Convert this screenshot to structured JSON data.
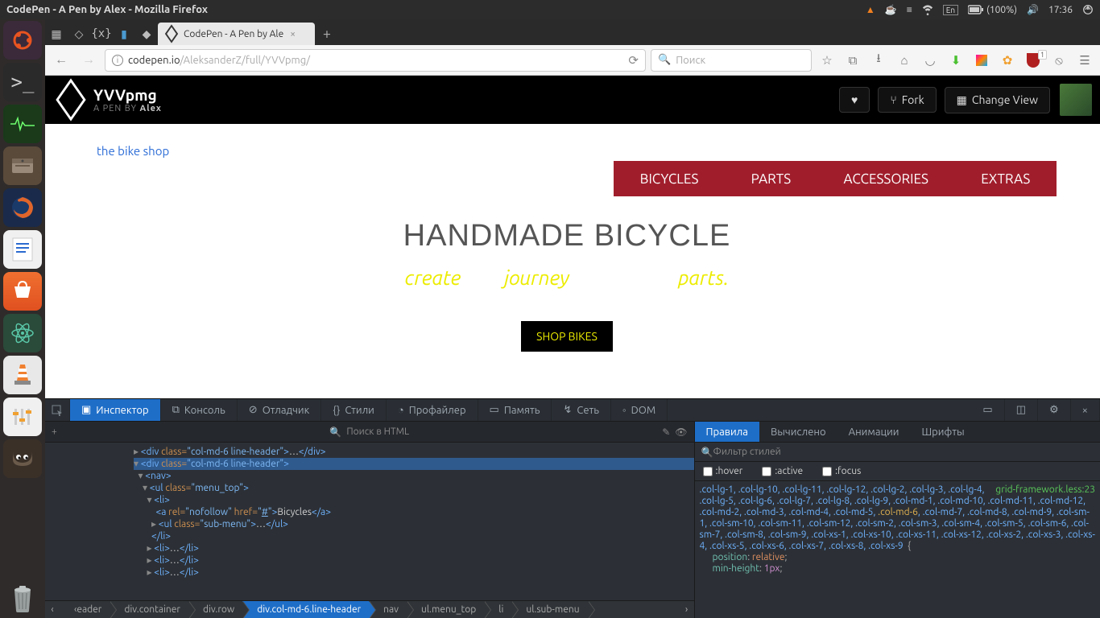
{
  "sysbar": {
    "title": "CodePen - A Pen by Alex - Mozilla Firefox",
    "battery": "(100%)",
    "lang": "En",
    "time": "17:36"
  },
  "tabs": {
    "active": "CodePen - A Pen by Ale"
  },
  "url": {
    "prefix": "codepen.io",
    "path": "/AleksanderZ/full/YVVpmg/",
    "search_placeholder": "Поиск"
  },
  "codepen": {
    "name": "YVVpmg",
    "by_prefix": "A PEN BY ",
    "author": "Alex",
    "fork": "Fork",
    "change_view": "Change View"
  },
  "page": {
    "shoplink": "the bike shop",
    "nav": [
      "BICYCLES",
      "PARTS",
      "ACCESSORIES",
      "EXTRAS"
    ],
    "h1": "HANDMADE BICYCLE",
    "subwords": [
      "create",
      "journey",
      "parts."
    ],
    "cta": "SHOP BIKES"
  },
  "devtools": {
    "tabs": [
      "Инспектор",
      "Консоль",
      "Отладчик",
      "Стили",
      "Профайлер",
      "Память",
      "Сеть",
      "DOM"
    ],
    "search_html": "Поиск в HTML",
    "rules_tabs": [
      "Правила",
      "Вычислено",
      "Анимации",
      "Шрифты"
    ],
    "filter": "Фильтр стилей",
    "pseudo": [
      ":hover",
      ":active",
      ":focus"
    ],
    "breadcrumb": [
      "‹eader",
      "div.container",
      "div.row",
      "div.col-md-6.line-header",
      "nav",
      "ul.menu_top",
      "li",
      "ul.sub-menu"
    ],
    "source": "grid-framework.less:23",
    "selectors": ".col-lg-1, .col-lg-10, .col-lg-11, .col-lg-12, .col-lg-2, .col-lg-3, .col-lg-4, .col-lg-5, .col-lg-6, .col-lg-7, .col-lg-8, .col-lg-9, .col-md-1, .col-md-10, .col-md-11, .col-md-12, .col-md-2, .col-md-3, .col-md-4, .col-md-5, ",
    "selector_hl": ".col-md-6",
    "selectors2": ", .col-md-7, .col-md-8, .col-md-9, .col-sm-1, .col-sm-10, .col-sm-11, .col-sm-12, .col-sm-2, .col-sm-3, .col-sm-4, .col-sm-5, .col-sm-6, .col-sm-7, .col-sm-8, .col-sm-9, .col-xs-1, .col-xs-10, .col-xs-11, .col-xs-12, .col-xs-2, .col-xs-3, .col-xs-4, .col-xs-5, .col-xs-6, .col-xs-7, .col-xs-8, .col-xs-9",
    "props": [
      {
        "name": "position",
        "value": "relative"
      },
      {
        "name": "min-height",
        "value": "1px"
      }
    ]
  }
}
